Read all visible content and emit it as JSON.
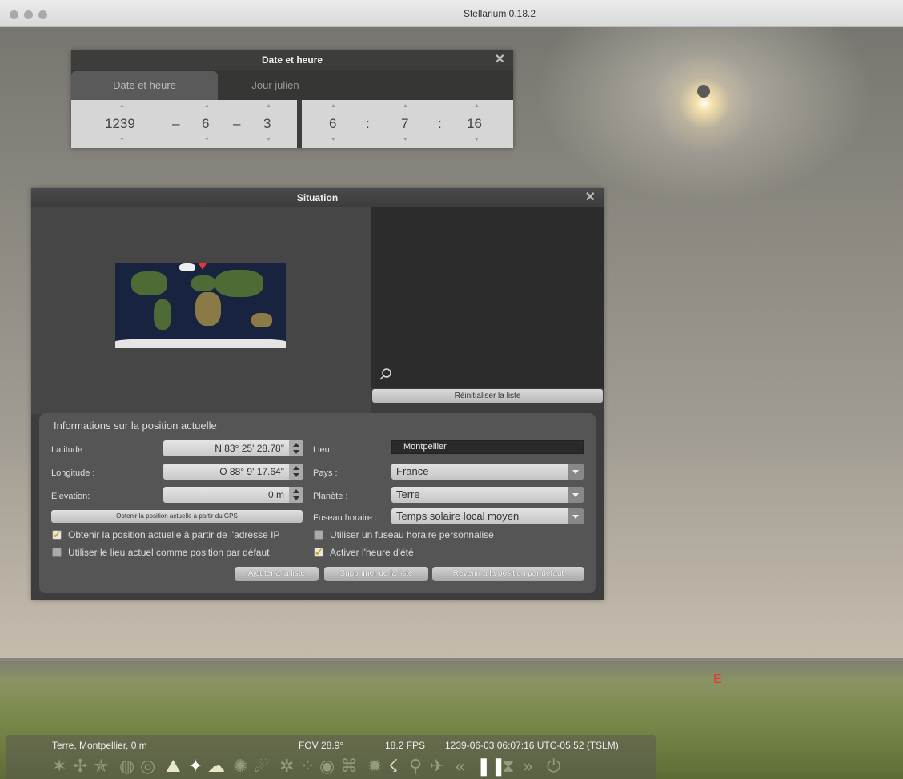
{
  "window": {
    "title": "Stellarium 0.18.2"
  },
  "date_dialog": {
    "title": "Date et heure",
    "tabs": [
      "Date et heure",
      "Jour julien"
    ],
    "year": "1239",
    "month": "6",
    "day": "3",
    "hour": "6",
    "minute": "7",
    "second": "16",
    "dash": "–",
    "colon": ":"
  },
  "situation_dialog": {
    "title": "Situation",
    "reset_list_label": "Réinitialiser la liste",
    "info_title": "Informations sur la position actuelle",
    "latitude_label": "Latitude :",
    "latitude_value": "N 83° 25' 28.78\"",
    "longitude_label": "Longitude :",
    "longitude_value": "O 88° 9' 17.64\"",
    "elevation_label": "Elevation:",
    "elevation_value": "0 m",
    "gps_button": "Obtenir la position actuelle à partir du GPS",
    "place_label": "Lieu :",
    "place_value": "Montpellier",
    "country_label": "Pays :",
    "country_value": "France",
    "planet_label": "Planète :",
    "planet_value": "Terre",
    "timezone_label": "Fuseau horaire :",
    "timezone_value": "Temps solaire local moyen",
    "checkboxes": {
      "ip_position": {
        "label": "Obtenir la position actuelle à partir de l'adresse IP",
        "checked": true
      },
      "default_position": {
        "label": "Utiliser le lieu actuel comme position par défaut",
        "checked": false
      },
      "custom_timezone": {
        "label": "Utiliser un fuseau horaire personnalisé",
        "checked": false
      },
      "dst": {
        "label": "Activer l'heure d'été",
        "checked": true
      }
    },
    "add_button": "Ajouter à la liste",
    "remove_button": "Supprimer de la liste",
    "revert_button": "Revenir à la position par défaut"
  },
  "sky": {
    "compass_label": "E"
  },
  "status_bar": {
    "location": "Terre, Montpellier, 0 m",
    "fov": "FOV 28.9°",
    "fps": "18.2 FPS",
    "datetime": "1239-06-03 06:07:16 UTC-05:52 (TSLM)"
  },
  "toolbar_icons": [
    "constellation-lines-icon",
    "constellation-labels-icon",
    "constellation-art-icon",
    "equatorial-grid-icon",
    "azimuthal-grid-icon",
    "ground-icon",
    "cardinal-points-icon",
    "atmosphere-icon",
    "nebulae-icon",
    "planets-labels-icon",
    "mount-icon",
    "night-mode-icon",
    "full-screen-icon",
    "ocular-icon",
    "satellites-icon",
    "meteor-icon",
    "search-icon",
    "plane-icon",
    "rewind-icon",
    "pause-icon",
    "real-time-icon",
    "forward-icon",
    "quit-icon"
  ]
}
